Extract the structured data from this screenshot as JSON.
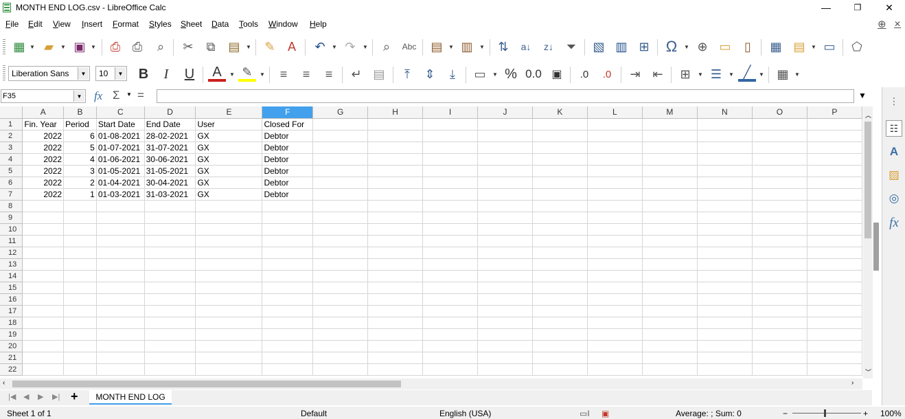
{
  "window": {
    "title": "MONTH END LOG.csv - LibreOffice Calc",
    "minimize": "—",
    "restore": "❐",
    "close": "✕"
  },
  "menu": [
    "File",
    "Edit",
    "View",
    "Insert",
    "Format",
    "Styles",
    "Sheet",
    "Data",
    "Tools",
    "Window",
    "Help"
  ],
  "formatting": {
    "font_name": "Liberation Sans",
    "font_size": "10",
    "percent": "%",
    "number_format": "0.0"
  },
  "formula_bar": {
    "cell_ref": "F35",
    "fx": "fx",
    "sum": "Σ",
    "equals": "=",
    "content": ""
  },
  "columns": [
    "A",
    "B",
    "C",
    "D",
    "E",
    "F",
    "G",
    "H",
    "I",
    "J",
    "K",
    "L",
    "M",
    "N",
    "O",
    "P"
  ],
  "selected_column": "F",
  "rows": [
    [
      "Fin. Year",
      "Period",
      "Start Date",
      "End Date",
      "User",
      "Closed For"
    ],
    [
      "2022",
      "6",
      "01-08-2021",
      "28-02-2021",
      "GX",
      "Debtor"
    ],
    [
      "2022",
      "5",
      "01-07-2021",
      "31-07-2021",
      "GX",
      "Debtor"
    ],
    [
      "2022",
      "4",
      "01-06-2021",
      "30-06-2021",
      "GX",
      "Debtor"
    ],
    [
      "2022",
      "3",
      "01-05-2021",
      "31-05-2021",
      "GX",
      "Debtor"
    ],
    [
      "2022",
      "2",
      "01-04-2021",
      "30-04-2021",
      "GX",
      "Debtor"
    ],
    [
      "2022",
      "1",
      "01-03-2021",
      "31-03-2021",
      "GX",
      "Debtor"
    ]
  ],
  "row_count": 22,
  "sheet_tabs": {
    "active": "MONTH END LOG",
    "add": "+"
  },
  "status": {
    "sheet": "Sheet 1 of 1",
    "page_style": "Default",
    "language": "English (USA)",
    "stats": "Average: ; Sum: 0",
    "zoom": "100%"
  }
}
